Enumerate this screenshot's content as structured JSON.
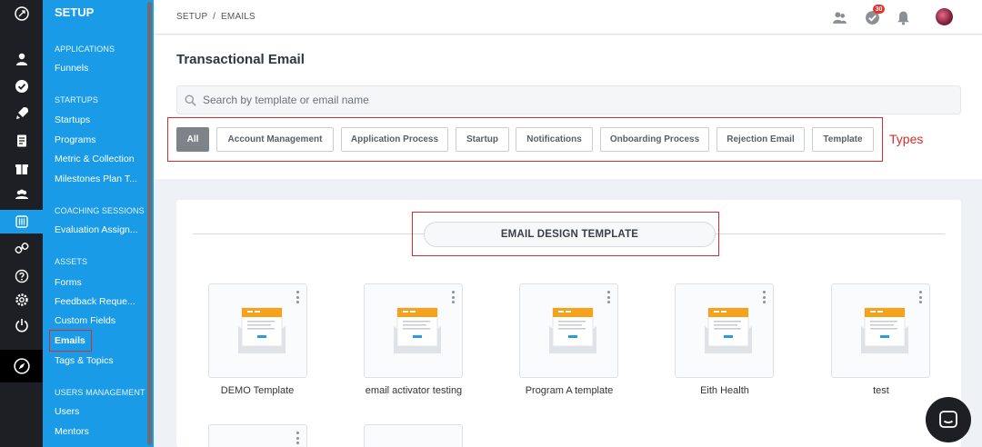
{
  "sidebar": {
    "title": "SETUP",
    "sections": [
      {
        "label": "APPLICATIONS",
        "items": [
          "Funnels"
        ]
      },
      {
        "label": "STARTUPS",
        "items": [
          "Startups",
          "Programs",
          "Metric & Collection",
          "Milestones Plan T..."
        ]
      },
      {
        "label": "COACHING SESSIONS",
        "items": [
          "Evaluation Assign..."
        ]
      },
      {
        "label": "ASSETS",
        "items": [
          "Forms",
          "Feedback Reque...",
          "Custom Fields",
          "Emails",
          "Tags & Topics"
        ]
      },
      {
        "label": "USERS MANAGEMENT",
        "items": [
          "Users",
          "Mentors"
        ]
      }
    ],
    "active_item": "Emails"
  },
  "header": {
    "breadcrumb": "SETUP  /  EMAILS",
    "notification_count": "30"
  },
  "main": {
    "title": "Transactional Email",
    "search": {
      "placeholder": "Search by template or email name",
      "value": ""
    },
    "types": [
      "All",
      "Account Management",
      "Application Process",
      "Startup",
      "Notifications",
      "Onboarding Process",
      "Rejection Email",
      "Template"
    ],
    "active_type": "All",
    "types_annotation": "Types",
    "section_title": "EMAIL DESIGN TEMPLATE",
    "templates": [
      "DEMO Template",
      "email activator testing",
      "Program A template",
      "Eith Health",
      "test"
    ]
  },
  "colors": {
    "sidebar_blue": "#1a9be8",
    "rail_dark": "#1d1f24",
    "annotation_red": "#d92c2c",
    "thumb_orange": "#f7a21b"
  }
}
